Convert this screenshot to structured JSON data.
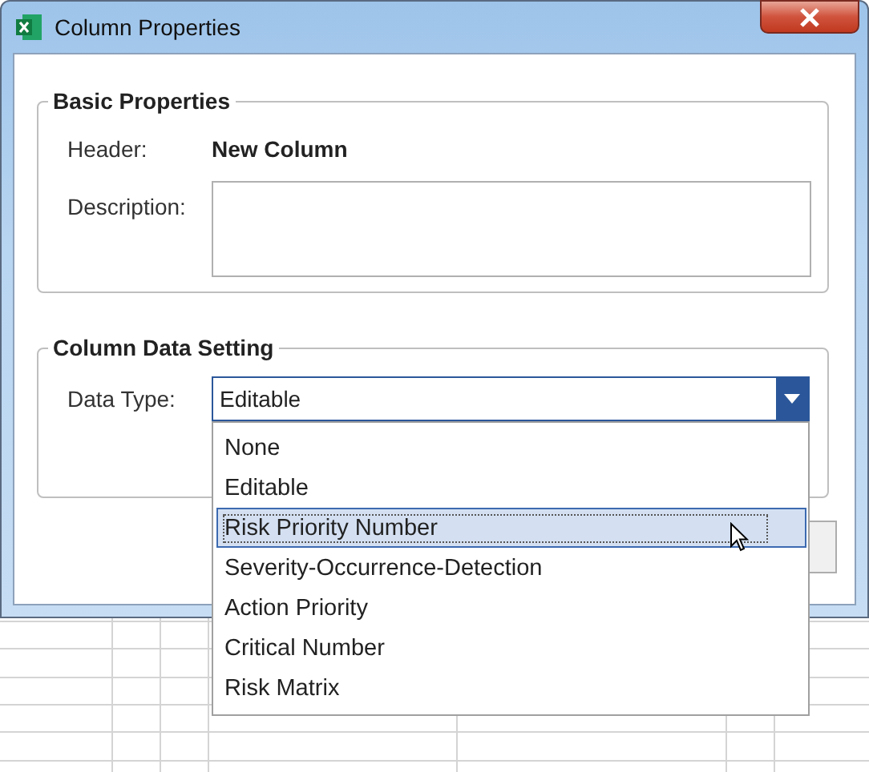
{
  "window": {
    "title": "Column Properties"
  },
  "basic_properties": {
    "title": "Basic Properties",
    "header_label": "Header:",
    "header_value": "New Column",
    "description_label": "Description:"
  },
  "column_data_setting": {
    "title": "Column Data Setting",
    "data_type_label": "Data Type:",
    "data_type_value": "Editable",
    "expanded": true,
    "options": [
      {
        "label": "None",
        "selected": false
      },
      {
        "label": "Editable",
        "selected": false
      },
      {
        "label": "Risk Priority Number",
        "selected": true
      },
      {
        "label": "Severity-Occurrence-Detection",
        "selected": false
      },
      {
        "label": "Action Priority",
        "selected": false
      },
      {
        "label": "Critical Number",
        "selected": false
      },
      {
        "label": "Risk Matrix",
        "selected": false
      }
    ]
  }
}
